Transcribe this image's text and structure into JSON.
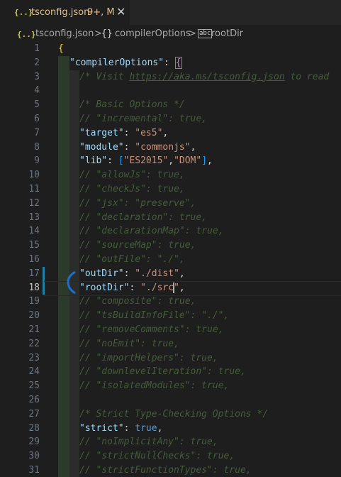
{
  "tab": {
    "icon": "{..}",
    "filename": "tsconfig.json",
    "badge": "9+, M",
    "close": "✕"
  },
  "breadcrumb": {
    "file_icon": "{..}",
    "file": "tsconfig.json",
    "sep1": ">",
    "obj_icon": "{}",
    "obj": "compilerOptions",
    "sep2": ">",
    "key_icon": "abc",
    "key": "rootDir"
  },
  "lines": [
    {
      "n": "1"
    },
    {
      "n": "2"
    },
    {
      "n": "3"
    },
    {
      "n": "4"
    },
    {
      "n": "5"
    },
    {
      "n": "6"
    },
    {
      "n": "7"
    },
    {
      "n": "8"
    },
    {
      "n": "9"
    },
    {
      "n": "10"
    },
    {
      "n": "11"
    },
    {
      "n": "12"
    },
    {
      "n": "13"
    },
    {
      "n": "14"
    },
    {
      "n": "15"
    },
    {
      "n": "16"
    },
    {
      "n": "17"
    },
    {
      "n": "18"
    },
    {
      "n": "19"
    },
    {
      "n": "20"
    },
    {
      "n": "21"
    },
    {
      "n": "22"
    },
    {
      "n": "23"
    },
    {
      "n": "24"
    },
    {
      "n": "25"
    },
    {
      "n": "26"
    },
    {
      "n": "27"
    },
    {
      "n": "28"
    },
    {
      "n": "29"
    },
    {
      "n": "30"
    },
    {
      "n": "31"
    }
  ],
  "code": {
    "l1": "{",
    "l2_key": "\"compilerOptions\"",
    "l2_colon": ": ",
    "l2_brace": "{",
    "l3_a": "/* Visit ",
    "l3_link": "https://aka.ms/tsconfig.json",
    "l3_b": " to read",
    "l5": "/* Basic Options */",
    "l6": "// \"incremental\": true,",
    "l7_key": "\"target\"",
    "l7_val": "\"es5\"",
    "l8_key": "\"module\"",
    "l8_val": "\"commonjs\"",
    "l9_key": "\"lib\"",
    "l9_v1": "\"ES2015\"",
    "l9_v2": "\"DOM\"",
    "l10": "// \"allowJs\": true,",
    "l11": "// \"checkJs\": true,",
    "l12": "// \"jsx\": \"preserve\",",
    "l13": "// \"declaration\": true,",
    "l14": "// \"declarationMap\": true,",
    "l15": "// \"sourceMap\": true,",
    "l16": "// \"outFile\": \"./\",",
    "l17_key": "\"outDir\"",
    "l17_val": "\"./dist\"",
    "l18_key": "\"rootDir\"",
    "l18_val_a": "\"./src",
    "l18_val_b": "\"",
    "l19": "// \"composite\": true,",
    "l20": "// \"tsBuildInfoFile\": \"./\",",
    "l21": "// \"removeComments\": true,",
    "l22": "// \"noEmit\": true,",
    "l23": "// \"importHelpers\": true,",
    "l24": "// \"downlevelIteration\": true,",
    "l25": "// \"isolatedModules\": true,",
    "l27": "/* Strict Type-Checking Options */",
    "l28_key": "\"strict\"",
    "l28_val": "true",
    "l29": "// \"noImplicitAny\": true,",
    "l30": "// \"strictNullChecks\": true,",
    "l31": "// \"strictFunctionTypes\": true,"
  },
  "colors": {
    "key": "#9cdcfe",
    "string": "#ce9178",
    "comment": "#6a9955",
    "bracket_gold": "#ffd700",
    "bracket_purple": "#da70d6",
    "modified_gutter": "#1b81a8"
  }
}
